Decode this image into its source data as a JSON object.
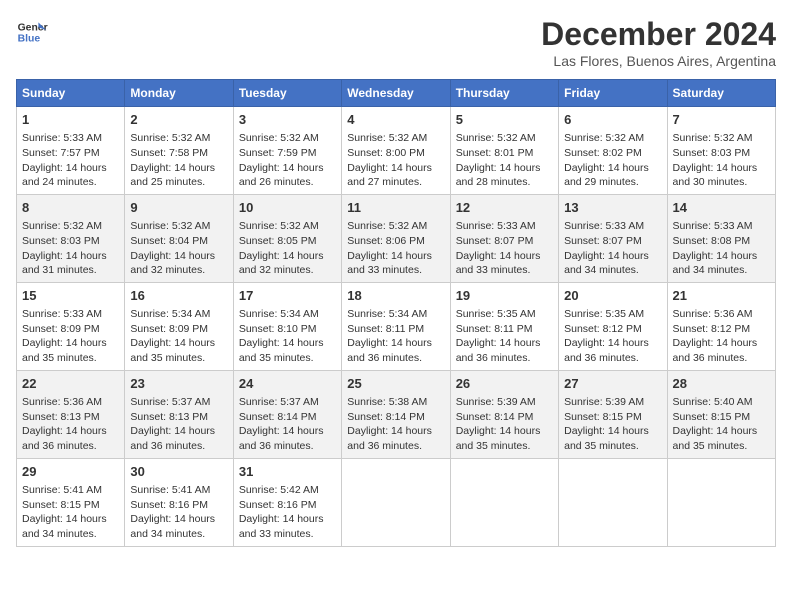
{
  "header": {
    "logo_line1": "General",
    "logo_line2": "Blue",
    "title": "December 2024",
    "subtitle": "Las Flores, Buenos Aires, Argentina"
  },
  "days_of_week": [
    "Sunday",
    "Monday",
    "Tuesday",
    "Wednesday",
    "Thursday",
    "Friday",
    "Saturday"
  ],
  "weeks": [
    [
      {
        "day": "1",
        "lines": [
          "Sunrise: 5:33 AM",
          "Sunset: 7:57 PM",
          "Daylight: 14 hours",
          "and 24 minutes."
        ]
      },
      {
        "day": "2",
        "lines": [
          "Sunrise: 5:32 AM",
          "Sunset: 7:58 PM",
          "Daylight: 14 hours",
          "and 25 minutes."
        ]
      },
      {
        "day": "3",
        "lines": [
          "Sunrise: 5:32 AM",
          "Sunset: 7:59 PM",
          "Daylight: 14 hours",
          "and 26 minutes."
        ]
      },
      {
        "day": "4",
        "lines": [
          "Sunrise: 5:32 AM",
          "Sunset: 8:00 PM",
          "Daylight: 14 hours",
          "and 27 minutes."
        ]
      },
      {
        "day": "5",
        "lines": [
          "Sunrise: 5:32 AM",
          "Sunset: 8:01 PM",
          "Daylight: 14 hours",
          "and 28 minutes."
        ]
      },
      {
        "day": "6",
        "lines": [
          "Sunrise: 5:32 AM",
          "Sunset: 8:02 PM",
          "Daylight: 14 hours",
          "and 29 minutes."
        ]
      },
      {
        "day": "7",
        "lines": [
          "Sunrise: 5:32 AM",
          "Sunset: 8:03 PM",
          "Daylight: 14 hours",
          "and 30 minutes."
        ]
      }
    ],
    [
      {
        "day": "8",
        "lines": [
          "Sunrise: 5:32 AM",
          "Sunset: 8:03 PM",
          "Daylight: 14 hours",
          "and 31 minutes."
        ]
      },
      {
        "day": "9",
        "lines": [
          "Sunrise: 5:32 AM",
          "Sunset: 8:04 PM",
          "Daylight: 14 hours",
          "and 32 minutes."
        ]
      },
      {
        "day": "10",
        "lines": [
          "Sunrise: 5:32 AM",
          "Sunset: 8:05 PM",
          "Daylight: 14 hours",
          "and 32 minutes."
        ]
      },
      {
        "day": "11",
        "lines": [
          "Sunrise: 5:32 AM",
          "Sunset: 8:06 PM",
          "Daylight: 14 hours",
          "and 33 minutes."
        ]
      },
      {
        "day": "12",
        "lines": [
          "Sunrise: 5:33 AM",
          "Sunset: 8:07 PM",
          "Daylight: 14 hours",
          "and 33 minutes."
        ]
      },
      {
        "day": "13",
        "lines": [
          "Sunrise: 5:33 AM",
          "Sunset: 8:07 PM",
          "Daylight: 14 hours",
          "and 34 minutes."
        ]
      },
      {
        "day": "14",
        "lines": [
          "Sunrise: 5:33 AM",
          "Sunset: 8:08 PM",
          "Daylight: 14 hours",
          "and 34 minutes."
        ]
      }
    ],
    [
      {
        "day": "15",
        "lines": [
          "Sunrise: 5:33 AM",
          "Sunset: 8:09 PM",
          "Daylight: 14 hours",
          "and 35 minutes."
        ]
      },
      {
        "day": "16",
        "lines": [
          "Sunrise: 5:34 AM",
          "Sunset: 8:09 PM",
          "Daylight: 14 hours",
          "and 35 minutes."
        ]
      },
      {
        "day": "17",
        "lines": [
          "Sunrise: 5:34 AM",
          "Sunset: 8:10 PM",
          "Daylight: 14 hours",
          "and 35 minutes."
        ]
      },
      {
        "day": "18",
        "lines": [
          "Sunrise: 5:34 AM",
          "Sunset: 8:11 PM",
          "Daylight: 14 hours",
          "and 36 minutes."
        ]
      },
      {
        "day": "19",
        "lines": [
          "Sunrise: 5:35 AM",
          "Sunset: 8:11 PM",
          "Daylight: 14 hours",
          "and 36 minutes."
        ]
      },
      {
        "day": "20",
        "lines": [
          "Sunrise: 5:35 AM",
          "Sunset: 8:12 PM",
          "Daylight: 14 hours",
          "and 36 minutes."
        ]
      },
      {
        "day": "21",
        "lines": [
          "Sunrise: 5:36 AM",
          "Sunset: 8:12 PM",
          "Daylight: 14 hours",
          "and 36 minutes."
        ]
      }
    ],
    [
      {
        "day": "22",
        "lines": [
          "Sunrise: 5:36 AM",
          "Sunset: 8:13 PM",
          "Daylight: 14 hours",
          "and 36 minutes."
        ]
      },
      {
        "day": "23",
        "lines": [
          "Sunrise: 5:37 AM",
          "Sunset: 8:13 PM",
          "Daylight: 14 hours",
          "and 36 minutes."
        ]
      },
      {
        "day": "24",
        "lines": [
          "Sunrise: 5:37 AM",
          "Sunset: 8:14 PM",
          "Daylight: 14 hours",
          "and 36 minutes."
        ]
      },
      {
        "day": "25",
        "lines": [
          "Sunrise: 5:38 AM",
          "Sunset: 8:14 PM",
          "Daylight: 14 hours",
          "and 36 minutes."
        ]
      },
      {
        "day": "26",
        "lines": [
          "Sunrise: 5:39 AM",
          "Sunset: 8:14 PM",
          "Daylight: 14 hours",
          "and 35 minutes."
        ]
      },
      {
        "day": "27",
        "lines": [
          "Sunrise: 5:39 AM",
          "Sunset: 8:15 PM",
          "Daylight: 14 hours",
          "and 35 minutes."
        ]
      },
      {
        "day": "28",
        "lines": [
          "Sunrise: 5:40 AM",
          "Sunset: 8:15 PM",
          "Daylight: 14 hours",
          "and 35 minutes."
        ]
      }
    ],
    [
      {
        "day": "29",
        "lines": [
          "Sunrise: 5:41 AM",
          "Sunset: 8:15 PM",
          "Daylight: 14 hours",
          "and 34 minutes."
        ]
      },
      {
        "day": "30",
        "lines": [
          "Sunrise: 5:41 AM",
          "Sunset: 8:16 PM",
          "Daylight: 14 hours",
          "and 34 minutes."
        ]
      },
      {
        "day": "31",
        "lines": [
          "Sunrise: 5:42 AM",
          "Sunset: 8:16 PM",
          "Daylight: 14 hours",
          "and 33 minutes."
        ]
      },
      null,
      null,
      null,
      null
    ]
  ]
}
